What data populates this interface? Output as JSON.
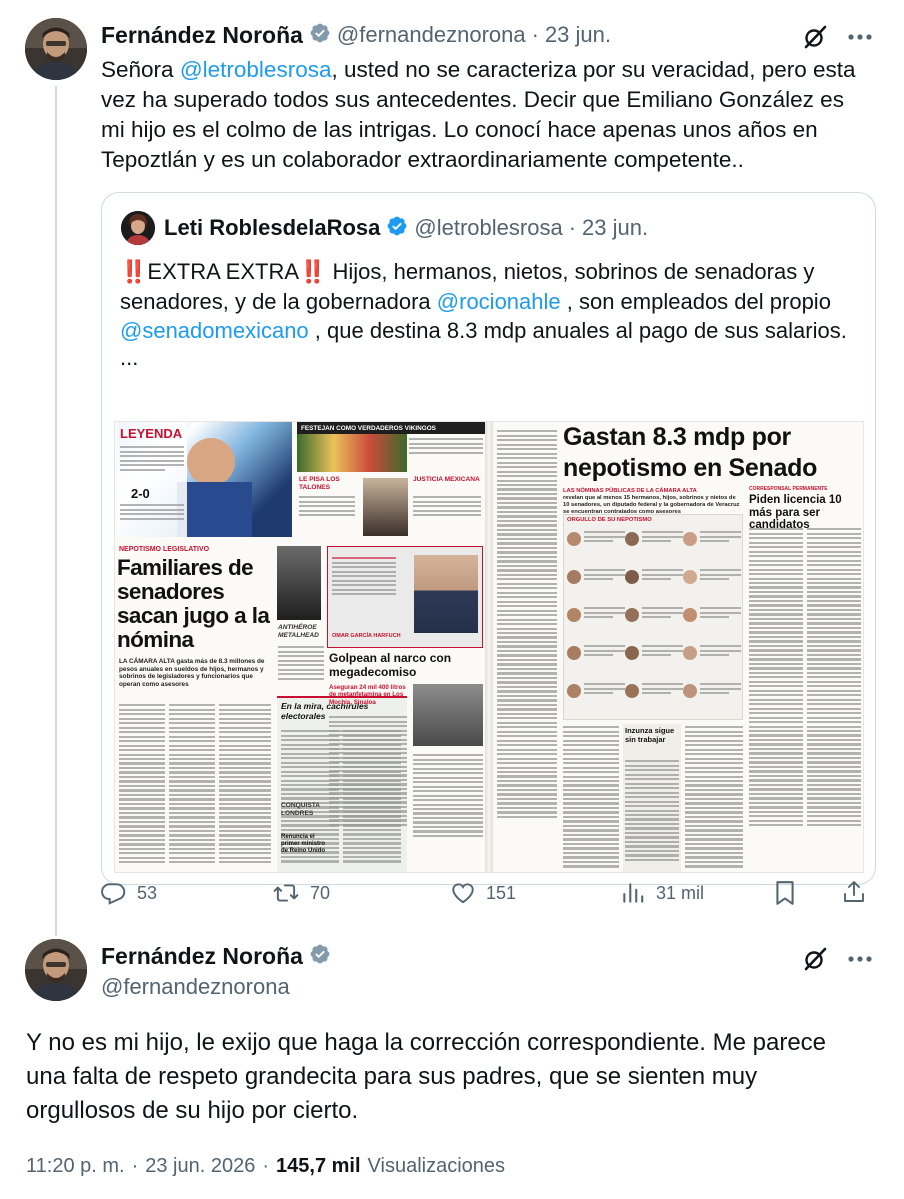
{
  "tweet1": {
    "author_name": "Fernández Noroña",
    "author_handle": "@fernandeznorona",
    "separator": "·",
    "date": "23 jun.",
    "text_before": "Señora ",
    "mention": "@letroblesrosa",
    "text_after": ", usted no se caracteriza por su veracidad, pero esta vez ha superado todos sus antecedentes. Decir que Emiliano González es mi hijo es el colmo de las intrigas. Lo conocí hace apenas unos años en Tepoztlán y es un colaborador extraordinariamente competente..",
    "quote": {
      "author_name": "Leti RoblesdelaRosa",
      "author_handle": "@letroblesrosa",
      "date": "23 jun.",
      "line1_emoji": "‼️",
      "line1_text": "EXTRA EXTRA",
      "text_p1": " Hijos, hermanos, nietos, sobrinos de senadoras y senadores, y de la gobernadora ",
      "mention1": "@rocionahle",
      "text_p2": " , son empleados del propio ",
      "mention2": "@senadomexicano",
      "text_p3": " , que destina 8.3 mdp anuales al pago de sus salarios.",
      "ellipsis": "...",
      "image": {
        "left_page": {
          "section_tag": "LEYENDA",
          "top_story_header": "FESTEJAN COMO VERDADEROS VIKINGOS",
          "score_label": "2-0",
          "side_label_1": "LE PISA LOS TALONES",
          "side_label_2": "JUSTICIA MEXICANA",
          "kicker": "NEPOTISMO LEGISLATIVO",
          "headline": "Familiares de senadores sacan jugo a la nómina",
          "subhead": "LA CÁMARA ALTA gasta más de 8.3 millones de pesos anuales en sueldos de hijos, hermanos y sobrinos de legisladores y funcionarios que operan como asesores",
          "secondary_headline": "Golpean al narco con megadecomiso",
          "secondary_deck": "Aseguran 24 mil 400 litros de metanfetamina en Los Mochis, Sinaloa",
          "box_headline": "En la mira, cachirules electorales",
          "box_headline_2": "ANTIHÉROE METALHEAD",
          "box_headline_3": "CONQUISTA LONDRES",
          "box_headline_4": "Renuncia el primer ministro de Reino Unido",
          "person_label": "OMAR GARCÍA HARFUCH"
        },
        "right_page": {
          "headline": "Gastan 8.3 mdp por nepotismo en Senado",
          "kicker": "LAS NÓMINAS PÚBLICAS DE LA CÁMARA ALTA",
          "deck": "revelan que al menos 15 hermanos, hijos, sobrinos y nietos de 10 senadores, un diputado federal y la gobernadora de Veracruz se encuentran contratados como asesores",
          "chart_title": "ORGULLO DE SU NEPOTISMO",
          "side_kicker": "CORRESPONSAL PERMANENTE",
          "side_headline": "Piden licencia 10 más para ser candidatos",
          "box_headline": "Inzunza sigue sin trabajar"
        }
      }
    },
    "stats": {
      "replies": "53",
      "retweets": "70",
      "likes": "151",
      "views": "31 mil"
    }
  },
  "tweet2": {
    "author_name": "Fernández Noroña",
    "author_handle": "@fernandeznorona",
    "text": "Y no es mi hijo, le exijo que haga la corrección correspondiente. Me parece una falta de respeto grandecita para sus padres, que se sienten muy orgullosos de su hijo por cierto.",
    "time": "11:20 p. m.",
    "separator": "·",
    "date": "23 jun. 2026",
    "separator2": "·",
    "views_count": "145,7 mil",
    "views_label": "Visualizaciones"
  },
  "icons": {
    "verified": "verified-badge-icon",
    "grok": "grok-icon",
    "more": "more-horizontal-icon",
    "reply": "reply-icon",
    "retweet": "retweet-icon",
    "like": "heart-icon",
    "views": "views-chart-icon",
    "bookmark": "bookmark-icon",
    "share": "share-icon"
  },
  "colors": {
    "accent": "#1d9bf0",
    "text": "#0f1419",
    "secondary_text": "#536471",
    "border": "#cfd9de",
    "paper_red": "#c8102e"
  }
}
